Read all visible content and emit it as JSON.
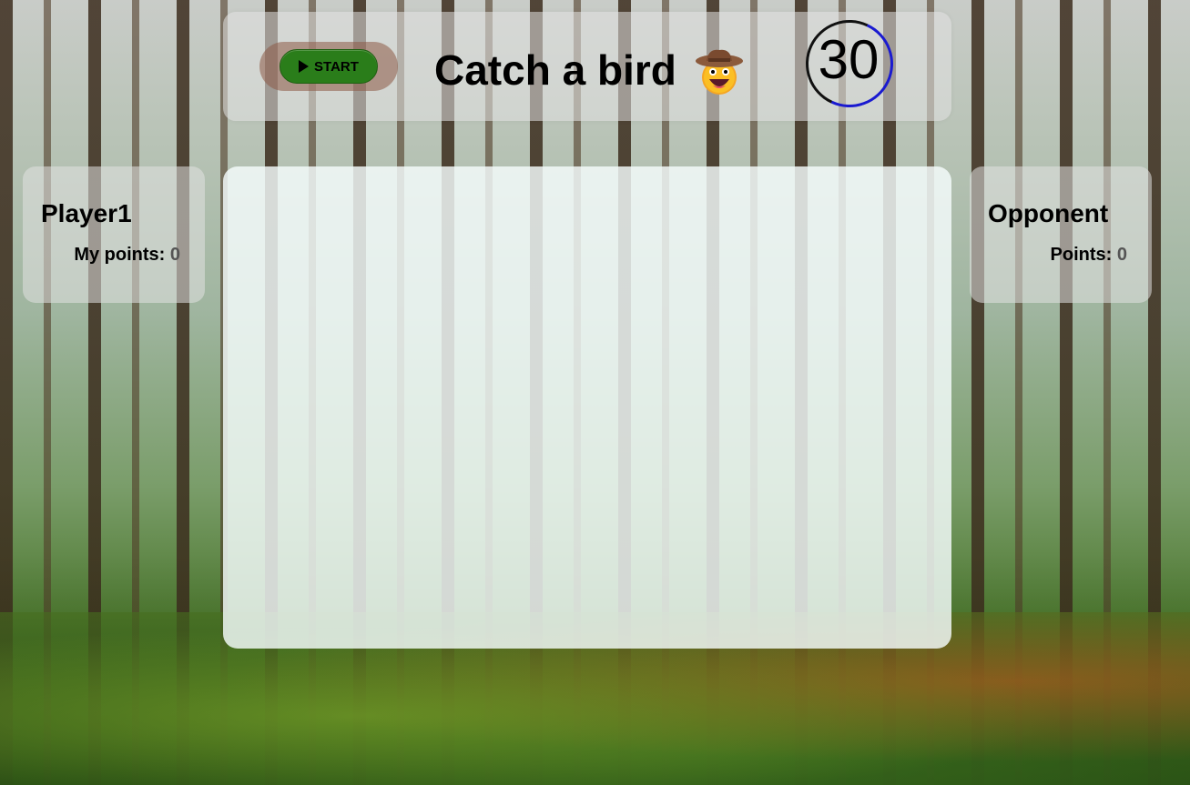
{
  "header": {
    "start_label": "START",
    "title": "Catch a bird",
    "timer": "30"
  },
  "player": {
    "name": "Player1",
    "points_label": "My points:",
    "points": "0"
  },
  "opponent": {
    "name": "Opponent",
    "points_label": "Points:",
    "points": "0"
  },
  "icons": {
    "start": "play-icon",
    "title_emoji": "cowboy-hat-face-icon"
  },
  "colors": {
    "start_button": "#2a7d1a",
    "timer_ring": "#1a1ad0"
  }
}
